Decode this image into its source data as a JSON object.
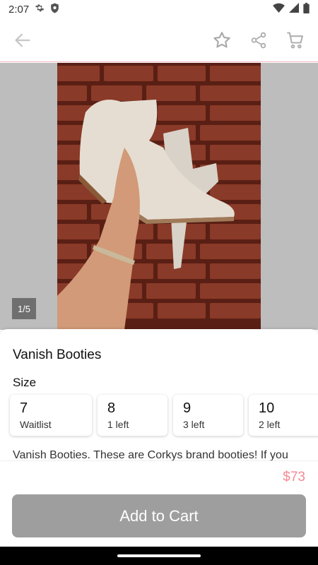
{
  "status_bar": {
    "time": "2:07"
  },
  "app_bar": {
    "back_icon": "arrow-left-icon",
    "favorite_icon": "star-outline-icon",
    "share_icon": "share-icon",
    "cart_icon": "cart-icon"
  },
  "gallery": {
    "counter": "1/5"
  },
  "product": {
    "title": "Vanish Booties",
    "size_label": "Size",
    "sizes": [
      {
        "size": "7",
        "stock": "Waitlist"
      },
      {
        "size": "8",
        "stock": "1 left"
      },
      {
        "size": "9",
        "stock": "3 left"
      },
      {
        "size": "10",
        "stock": "2 left"
      }
    ],
    "description": "Vanish Booties. These are Corkys brand booties! If you"
  },
  "checkout": {
    "price": "$73",
    "add_to_cart_label": "Add to Cart"
  },
  "colors": {
    "accent": "#f48a94",
    "button_disabled": "#9e9e9e",
    "divider": "#f2b7bf"
  }
}
